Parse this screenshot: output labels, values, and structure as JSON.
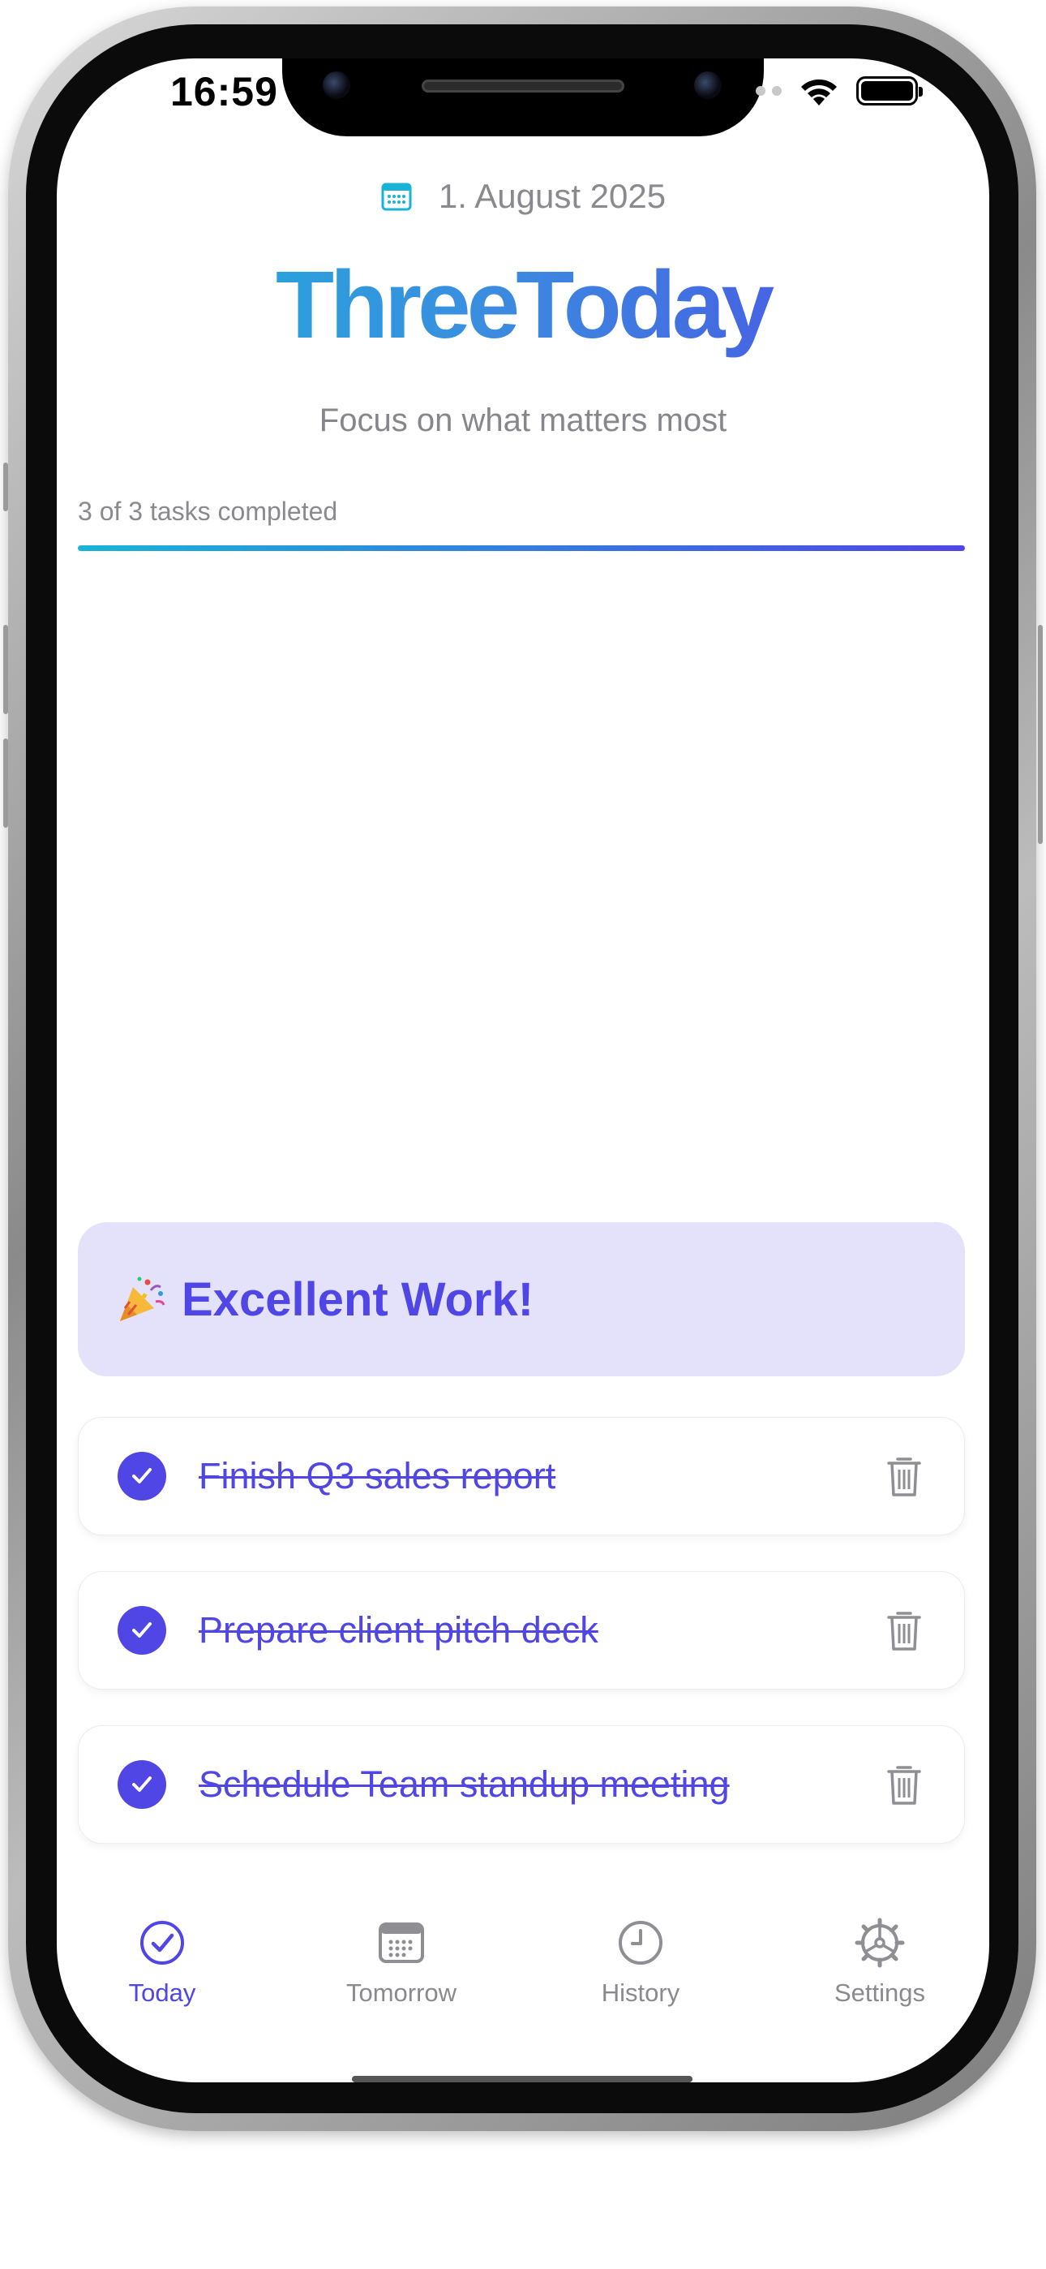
{
  "status_bar": {
    "time": "16:59"
  },
  "header": {
    "date": "1. August 2025",
    "app_title": "ThreeToday",
    "subtitle": "Focus on what matters most"
  },
  "progress": {
    "label": "3 of 3 tasks completed",
    "completed": 3,
    "total": 3,
    "fraction": 1.0
  },
  "celebration": {
    "emoji": "🎉",
    "message": "Excellent Work!"
  },
  "tasks": [
    {
      "title": "Finish Q3 sales report",
      "completed": true
    },
    {
      "title": "Prepare client pitch deck",
      "completed": true
    },
    {
      "title": "Schedule Team standup meeting",
      "completed": true
    }
  ],
  "tabbar": {
    "items": [
      {
        "label": "Today",
        "icon": "checkmark-circle-icon",
        "active": true
      },
      {
        "label": "Tomorrow",
        "icon": "calendar-icon",
        "active": false
      },
      {
        "label": "History",
        "icon": "clock-icon",
        "active": false
      },
      {
        "label": "Settings",
        "icon": "gear-icon",
        "active": false
      }
    ]
  },
  "colors": {
    "accent": "#4f46e5",
    "accent_start": "#1ab3d8",
    "celebration_bg": "#e3e2fa",
    "muted_text": "#8a8a8e"
  }
}
